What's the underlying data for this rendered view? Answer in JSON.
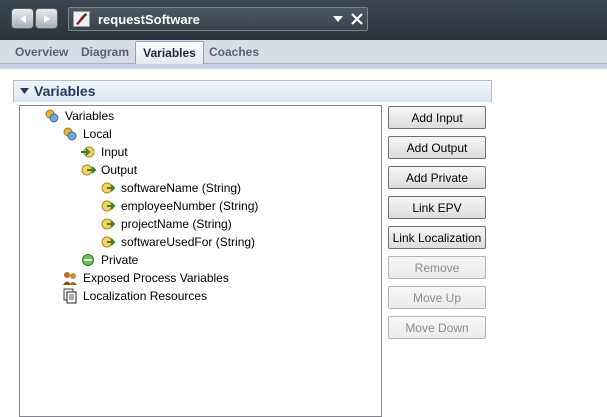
{
  "window": {
    "title": "requestSoftware"
  },
  "tabs": [
    {
      "label": "Overview"
    },
    {
      "label": "Diagram"
    },
    {
      "label": "Variables",
      "active": true
    },
    {
      "label": "Coaches"
    }
  ],
  "section": {
    "title": "Variables",
    "expanded": true
  },
  "tree": {
    "root": "Variables",
    "local": "Local",
    "input": "Input",
    "output": "Output",
    "output_vars": [
      "softwareName (String)",
      "employeeNumber (String)",
      "projectName (String)",
      "softwareUsedFor (String)"
    ],
    "private": "Private",
    "exposed": "Exposed Process Variables",
    "localization": "Localization Resources"
  },
  "buttons": {
    "add_input": {
      "label": "Add Input",
      "enabled": true
    },
    "add_output": {
      "label": "Add Output",
      "enabled": true
    },
    "add_private": {
      "label": "Add Private",
      "enabled": true
    },
    "link_epv": {
      "label": "Link EPV",
      "enabled": true
    },
    "link_localization": {
      "label": "Link Localization",
      "enabled": true
    },
    "remove": {
      "label": "Remove",
      "enabled": false
    },
    "move_up": {
      "label": "Move Up",
      "enabled": false
    },
    "move_down": {
      "label": "Move Down",
      "enabled": false
    }
  },
  "colors": {
    "topbar": "#333c45",
    "tab_strip": "#d7dde4",
    "section_title": "#1f3b5c",
    "disabled_text": "#8c8c8c"
  }
}
